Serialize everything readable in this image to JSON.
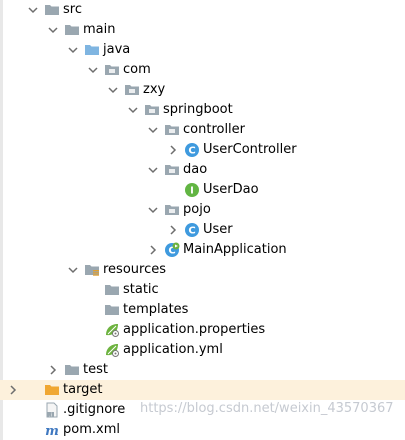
{
  "tree": {
    "src": "src",
    "main": "main",
    "java": "java",
    "com": "com",
    "zxy": "zxy",
    "springboot": "springboot",
    "controller": "controller",
    "user_controller": "UserController",
    "dao": "dao",
    "user_dao": "UserDao",
    "pojo": "pojo",
    "user": "User",
    "main_application": "MainApplication",
    "resources": "resources",
    "static": "static",
    "templates": "templates",
    "application_properties": "application.properties",
    "application_yml": "application.yml",
    "test": "test",
    "target": "target",
    "gitignore": ".gitignore",
    "pom": "pom.xml"
  },
  "icons": {
    "folder": "folder-icon",
    "source_folder": "source-root-folder-icon",
    "resources_folder": "resources-folder-icon",
    "excluded_folder": "excluded-folder-icon",
    "class": "java-class-icon",
    "interface": "java-interface-icon",
    "spring_boot_app": "spring-boot-application-icon",
    "spring_config": "spring-config-icon",
    "gitignore": "gitignore-file-icon",
    "maven": "maven-pom-icon"
  },
  "colors": {
    "folder": "#9aa7b0",
    "source_folder": "#7fb5e1",
    "excluded_folder": "#f0a732",
    "class_icon": "#3f9ade",
    "interface_icon": "#62b543",
    "spring": "#6db33f",
    "selected_row_bg": "#fdf1dc"
  },
  "watermark": "https://blog.csdn.net/weixin_43570367"
}
